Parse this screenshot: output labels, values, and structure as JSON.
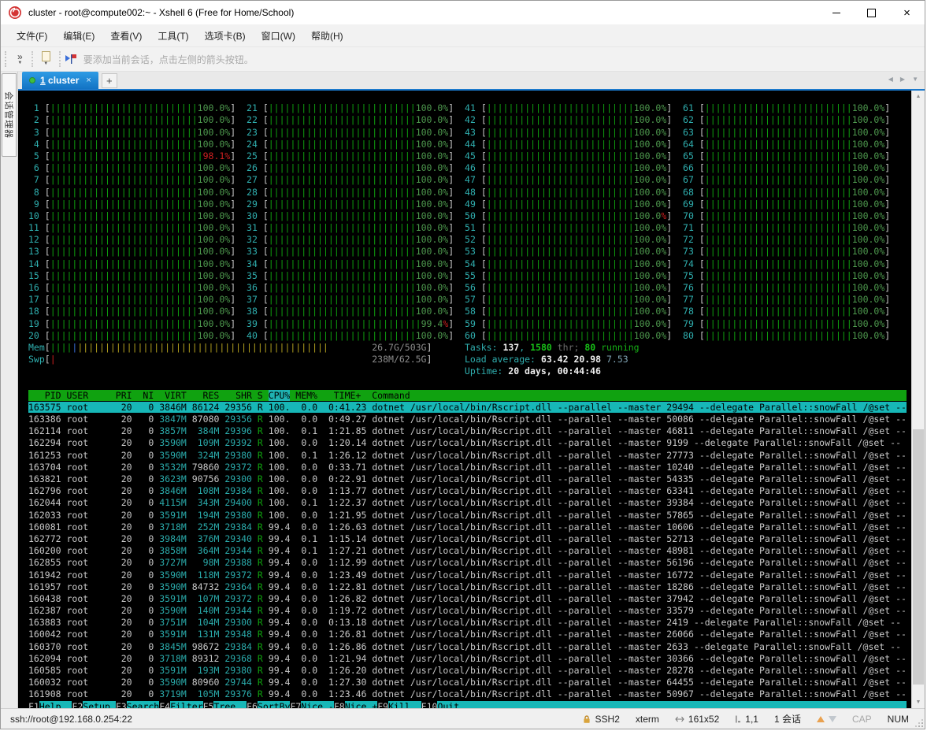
{
  "window": {
    "title": "cluster - root@compute002:~ - Xshell 6 (Free for Home/School)"
  },
  "menubar": {
    "items": [
      "文件(F)",
      "编辑(E)",
      "查看(V)",
      "工具(T)",
      "选项卡(B)",
      "窗口(W)",
      "帮助(H)"
    ]
  },
  "toolbar": {
    "hint": "要添加当前会话，点击左侧的箭头按钮。"
  },
  "tabbar": {
    "active_tab": {
      "index": "1",
      "label": " cluster",
      "close": "×"
    },
    "new_tab_label": "+"
  },
  "sidebar": {
    "vertical_tab_label": "会话管理器"
  },
  "terminal": {
    "size": {
      "cols": 161,
      "rows": 52
    },
    "cpus": {
      "count": 80,
      "default_value": "100.0%",
      "overrides": {
        "5": {
          "value": "98.1%",
          "style": "value-red"
        },
        "39": {
          "value": "99.4%",
          "style": "percent-red"
        },
        "50": {
          "value": "100.0%",
          "style": "percent-red"
        }
      }
    },
    "mem": {
      "label": "Mem",
      "display": "26.7G/503G",
      "pipes": {
        "green": 4,
        "blue": 1,
        "yellow": 46
      }
    },
    "swp": {
      "label": "Swp",
      "display": "238M/62.5G",
      "pipes": {
        "red": 1
      }
    },
    "tasks": {
      "label": "Tasks:",
      "count": "137",
      "threads": "1580",
      "threads_suffix": "thr;",
      "running": "80",
      "running_suffix": "running"
    },
    "load": {
      "label": "Load average:",
      "one": "63.42",
      "five": "20.98",
      "fifteen": "7.53"
    },
    "uptime": {
      "label": "Uptime:",
      "value": "20 days, 00:44:46"
    },
    "table": {
      "headers": {
        "pid": "PID",
        "user": "USER",
        "pri": "PRI",
        "ni": "NI",
        "virt": "VIRT",
        "res": "RES",
        "shr": "SHR",
        "s": "S",
        "cpu": "CPU%",
        "mem": "MEM%",
        "time": "TIME+",
        "command": "Command"
      },
      "sort_column": "cpu",
      "selected_index": 0,
      "command_template": "dotnet /usr/local/bin/Rscript.dll --parallel --master {master} --delegate Parallel::snowFall /@set --",
      "rows": [
        {
          "pid": "163575",
          "user": "root",
          "pri": "20",
          "ni": "0",
          "virt": "3846M",
          "res": "86124",
          "shr": "29356",
          "s": "R",
          "cpu": "100.",
          "mem": "0.0",
          "time": "0:41.23",
          "master": "29494"
        },
        {
          "pid": "163386",
          "user": "root",
          "pri": "20",
          "ni": "0",
          "virt": "3847M",
          "res": "87080",
          "shr": "29356",
          "s": "R",
          "cpu": "100.",
          "mem": "0.0",
          "time": "0:49.27",
          "master": "50086"
        },
        {
          "pid": "162114",
          "user": "root",
          "pri": "20",
          "ni": "0",
          "virt": "3857M",
          "res": "384M",
          "shr": "29396",
          "s": "R",
          "cpu": "100.",
          "mem": "0.1",
          "time": "1:21.85",
          "master": "46811"
        },
        {
          "pid": "162294",
          "user": "root",
          "pri": "20",
          "ni": "0",
          "virt": "3590M",
          "res": "109M",
          "shr": "29392",
          "s": "R",
          "cpu": "100.",
          "mem": "0.0",
          "time": "1:20.14",
          "master": "9199"
        },
        {
          "pid": "161253",
          "user": "root",
          "pri": "20",
          "ni": "0",
          "virt": "3590M",
          "res": "324M",
          "shr": "29380",
          "s": "R",
          "cpu": "100.",
          "mem": "0.1",
          "time": "1:26.12",
          "master": "27773"
        },
        {
          "pid": "163704",
          "user": "root",
          "pri": "20",
          "ni": "0",
          "virt": "3532M",
          "res": "79860",
          "shr": "29372",
          "s": "R",
          "cpu": "100.",
          "mem": "0.0",
          "time": "0:33.71",
          "master": "10240"
        },
        {
          "pid": "163821",
          "user": "root",
          "pri": "20",
          "ni": "0",
          "virt": "3623M",
          "res": "90756",
          "shr": "29300",
          "s": "R",
          "cpu": "100.",
          "mem": "0.0",
          "time": "0:22.91",
          "master": "54335"
        },
        {
          "pid": "162796",
          "user": "root",
          "pri": "20",
          "ni": "0",
          "virt": "3846M",
          "res": "108M",
          "shr": "29384",
          "s": "R",
          "cpu": "100.",
          "mem": "0.0",
          "time": "1:13.77",
          "master": "63341"
        },
        {
          "pid": "162044",
          "user": "root",
          "pri": "20",
          "ni": "0",
          "virt": "4115M",
          "res": "343M",
          "shr": "29400",
          "s": "R",
          "cpu": "100.",
          "mem": "0.1",
          "time": "1:22.37",
          "master": "39384"
        },
        {
          "pid": "162033",
          "user": "root",
          "pri": "20",
          "ni": "0",
          "virt": "3591M",
          "res": "194M",
          "shr": "29380",
          "s": "R",
          "cpu": "100.",
          "mem": "0.0",
          "time": "1:21.95",
          "master": "57865"
        },
        {
          "pid": "160081",
          "user": "root",
          "pri": "20",
          "ni": "0",
          "virt": "3718M",
          "res": "252M",
          "shr": "29384",
          "s": "R",
          "cpu": "99.4",
          "mem": "0.0",
          "time": "1:26.63",
          "master": "10606"
        },
        {
          "pid": "162772",
          "user": "root",
          "pri": "20",
          "ni": "0",
          "virt": "3984M",
          "res": "376M",
          "shr": "29340",
          "s": "R",
          "cpu": "99.4",
          "mem": "0.1",
          "time": "1:15.14",
          "master": "52713"
        },
        {
          "pid": "160200",
          "user": "root",
          "pri": "20",
          "ni": "0",
          "virt": "3858M",
          "res": "364M",
          "shr": "29344",
          "s": "R",
          "cpu": "99.4",
          "mem": "0.1",
          "time": "1:27.21",
          "master": "48981"
        },
        {
          "pid": "162855",
          "user": "root",
          "pri": "20",
          "ni": "0",
          "virt": "3727M",
          "res": "98M",
          "shr": "29388",
          "s": "R",
          "cpu": "99.4",
          "mem": "0.0",
          "time": "1:12.99",
          "master": "56196"
        },
        {
          "pid": "161942",
          "user": "root",
          "pri": "20",
          "ni": "0",
          "virt": "3590M",
          "res": "118M",
          "shr": "29372",
          "s": "R",
          "cpu": "99.4",
          "mem": "0.0",
          "time": "1:23.49",
          "master": "16772"
        },
        {
          "pid": "161957",
          "user": "root",
          "pri": "20",
          "ni": "0",
          "virt": "3590M",
          "res": "84732",
          "shr": "29364",
          "s": "R",
          "cpu": "99.4",
          "mem": "0.0",
          "time": "1:22.81",
          "master": "18286"
        },
        {
          "pid": "160438",
          "user": "root",
          "pri": "20",
          "ni": "0",
          "virt": "3591M",
          "res": "107M",
          "shr": "29372",
          "s": "R",
          "cpu": "99.4",
          "mem": "0.0",
          "time": "1:26.82",
          "master": "37942"
        },
        {
          "pid": "162387",
          "user": "root",
          "pri": "20",
          "ni": "0",
          "virt": "3590M",
          "res": "140M",
          "shr": "29344",
          "s": "R",
          "cpu": "99.4",
          "mem": "0.0",
          "time": "1:19.72",
          "master": "33579"
        },
        {
          "pid": "163883",
          "user": "root",
          "pri": "20",
          "ni": "0",
          "virt": "3751M",
          "res": "104M",
          "shr": "29300",
          "s": "R",
          "cpu": "99.4",
          "mem": "0.0",
          "time": "0:13.18",
          "master": "2419"
        },
        {
          "pid": "160042",
          "user": "root",
          "pri": "20",
          "ni": "0",
          "virt": "3591M",
          "res": "131M",
          "shr": "29348",
          "s": "R",
          "cpu": "99.4",
          "mem": "0.0",
          "time": "1:26.81",
          "master": "26066"
        },
        {
          "pid": "160370",
          "user": "root",
          "pri": "20",
          "ni": "0",
          "virt": "3845M",
          "res": "98672",
          "shr": "29384",
          "s": "R",
          "cpu": "99.4",
          "mem": "0.0",
          "time": "1:26.86",
          "master": "2633"
        },
        {
          "pid": "162094",
          "user": "root",
          "pri": "20",
          "ni": "0",
          "virt": "3718M",
          "res": "89312",
          "shr": "29368",
          "s": "R",
          "cpu": "99.4",
          "mem": "0.0",
          "time": "1:21.94",
          "master": "30366"
        },
        {
          "pid": "160585",
          "user": "root",
          "pri": "20",
          "ni": "0",
          "virt": "3591M",
          "res": "193M",
          "shr": "29380",
          "s": "R",
          "cpu": "99.4",
          "mem": "0.0",
          "time": "1:26.20",
          "master": "28278"
        },
        {
          "pid": "160032",
          "user": "root",
          "pri": "20",
          "ni": "0",
          "virt": "3590M",
          "res": "80960",
          "shr": "29744",
          "s": "R",
          "cpu": "99.4",
          "mem": "0.0",
          "time": "1:27.30",
          "master": "64455"
        },
        {
          "pid": "161908",
          "user": "root",
          "pri": "20",
          "ni": "0",
          "virt": "3719M",
          "res": "105M",
          "shr": "29376",
          "s": "R",
          "cpu": "99.4",
          "mem": "0.0",
          "time": "1:23.46",
          "master": "50967"
        }
      ]
    },
    "fnkeys": [
      {
        "key": "F1",
        "label": "Help"
      },
      {
        "key": "F2",
        "label": "Setup"
      },
      {
        "key": "F3",
        "label": "Search"
      },
      {
        "key": "F4",
        "label": "Filter"
      },
      {
        "key": "F5",
        "label": "Tree"
      },
      {
        "key": "F6",
        "label": "SortBy"
      },
      {
        "key": "F7",
        "label": "Nice -"
      },
      {
        "key": "F8",
        "label": "Nice +"
      },
      {
        "key": "F9",
        "label": "Kill"
      },
      {
        "key": "F10",
        "label": "Quit"
      }
    ],
    "colors": {
      "accent_cyan": "#17b7b7",
      "accent_green": "#10a210",
      "pipe_green": "#0fa00f",
      "pipe_yellow": "#b3a120",
      "alert_red": "#cf2020"
    }
  },
  "statusbar": {
    "url": "ssh://root@192.168.0.254:22",
    "protocol": "SSH2",
    "terminal_type": "xterm",
    "size": "161x52",
    "cursor": "1,1",
    "session_count": "1 会话",
    "cap": "CAP",
    "num": "NUM"
  }
}
